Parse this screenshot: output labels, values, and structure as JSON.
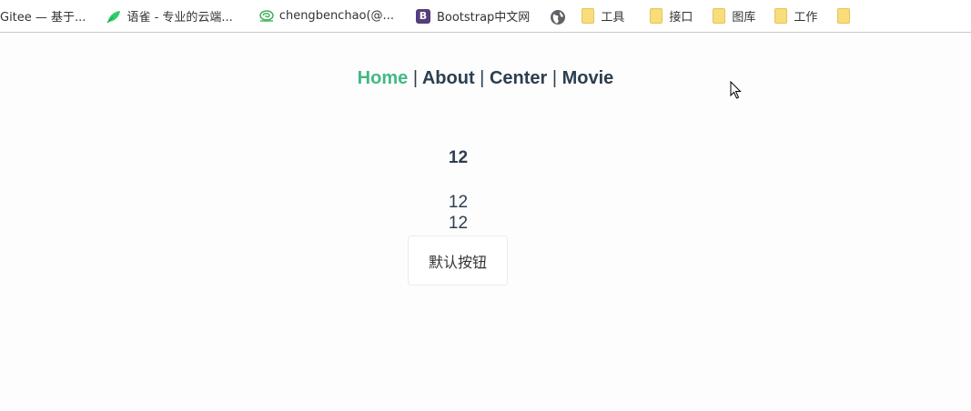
{
  "bookmarks": [
    {
      "label": "Gitee — 基于...",
      "icon": "none"
    },
    {
      "label": "语雀 - 专业的云端...",
      "icon": "yuque-leaf-icon"
    },
    {
      "label": "chengbenchao(@...",
      "icon": "cloud-swirl-icon"
    },
    {
      "label": "Bootstrap中文网",
      "icon": "bootstrap-icon",
      "icon_text": "B"
    },
    {
      "label": "",
      "icon": "globe-icon"
    },
    {
      "label": "工具",
      "icon": "folder-icon"
    },
    {
      "label": "接口",
      "icon": "folder-icon"
    },
    {
      "label": "图库",
      "icon": "folder-icon"
    },
    {
      "label": "工作",
      "icon": "folder-icon"
    },
    {
      "label": "",
      "icon": "folder-icon"
    }
  ],
  "nav": {
    "home": "Home",
    "about": "About",
    "center": "Center",
    "movie": "Movie",
    "separator": "|"
  },
  "content": {
    "heading": "12",
    "line1": "12",
    "line2": "12",
    "button_label": "默认按钮"
  },
  "colors": {
    "active_link": "#42b983",
    "text": "#2c3e50",
    "folder": "#f9dd7a",
    "bootstrap": "#563d7c"
  }
}
